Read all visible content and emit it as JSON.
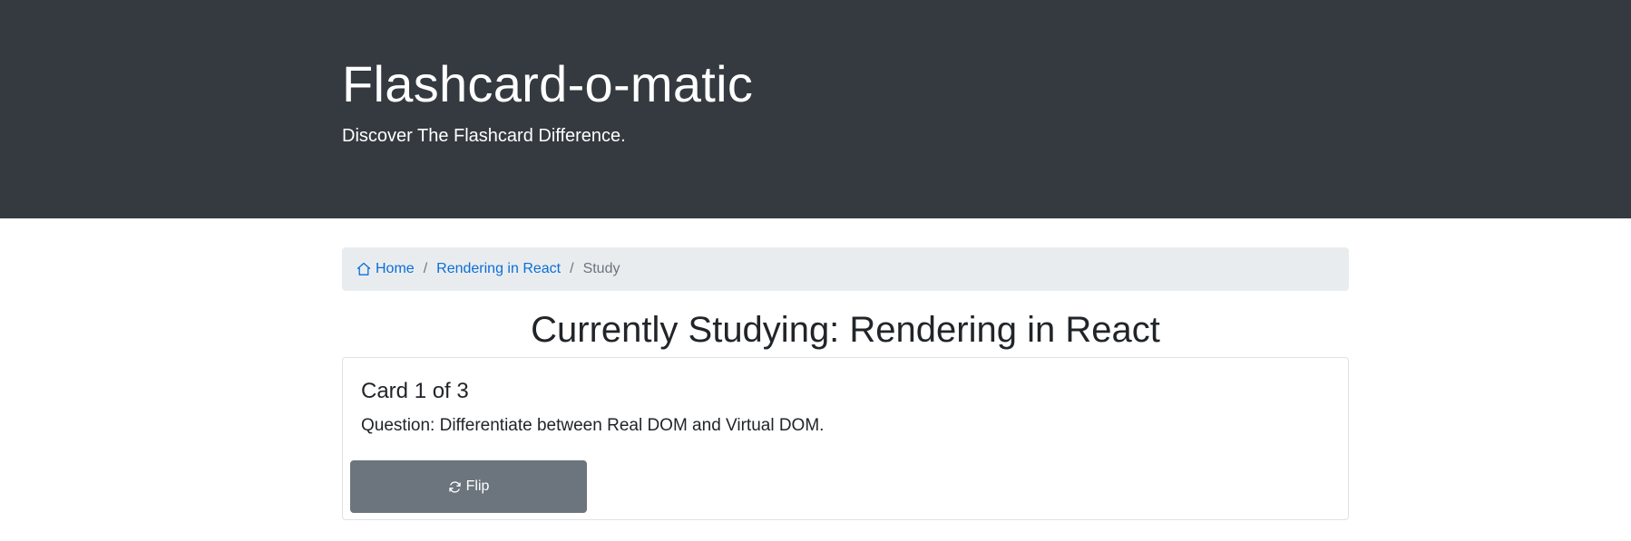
{
  "header": {
    "title": "Flashcard-o-matic",
    "tagline": "Discover The Flashcard Difference."
  },
  "breadcrumb": {
    "home_label": "Home",
    "deck_label": "Rendering in React",
    "current_label": "Study",
    "separator": "/"
  },
  "page": {
    "title": "Currently Studying: Rendering in React"
  },
  "card": {
    "counter": "Card 1 of 3",
    "question": "Question: Differentiate between Real DOM and Virtual DOM.",
    "flip_label": "Flip"
  },
  "icons": {
    "home": "home-icon",
    "flip": "arrow-repeat-icon"
  },
  "colors": {
    "header_bg": "#343a40",
    "link": "#0a6fd8",
    "breadcrumb_bg": "#e9ecef",
    "button_secondary": "#6c757d"
  }
}
